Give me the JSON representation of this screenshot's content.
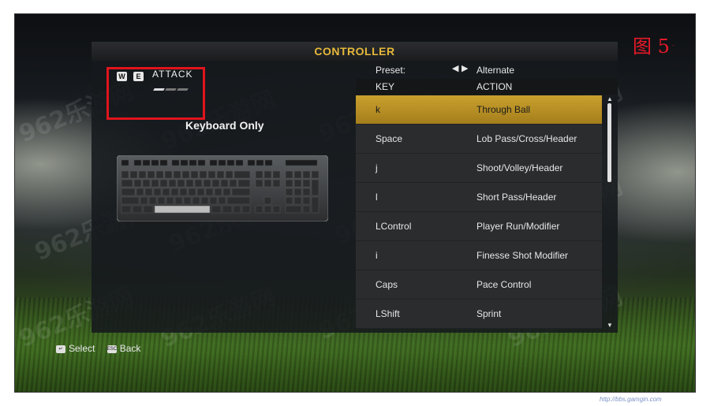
{
  "figure_label": "图 5",
  "figure_suffix": "..",
  "title": "CONTROLLER",
  "attack_section": {
    "badge_1": "W",
    "badge_2": "E",
    "label": "ATTACK"
  },
  "mode_label": "Keyboard Only",
  "preset": {
    "label": "Preset:",
    "value": "Alternate"
  },
  "columns": {
    "key": "KEY",
    "action": "ACTION"
  },
  "bindings": [
    {
      "key": "k",
      "action": "Through Ball",
      "selected": true
    },
    {
      "key": "Space",
      "action": "Lob Pass/Cross/Header"
    },
    {
      "key": "j",
      "action": "Shoot/Volley/Header"
    },
    {
      "key": "l",
      "action": "Short Pass/Header"
    },
    {
      "key": "LControl",
      "action": "Player Run/Modifier"
    },
    {
      "key": "i",
      "action": "Finesse Shot Modifier"
    },
    {
      "key": "Caps",
      "action": "Pace Control"
    },
    {
      "key": "LShift",
      "action": "Sprint"
    }
  ],
  "footer": {
    "select_label": "Select",
    "back_label": "Back",
    "back_icon_text": "ESC"
  },
  "watermark_text": "962乐游网",
  "corner_url": "http://bbs.gamgin.com",
  "colors": {
    "accent": "#e6b73a",
    "selected_row": "#b88f24",
    "annotation_red": "#e0141c"
  }
}
